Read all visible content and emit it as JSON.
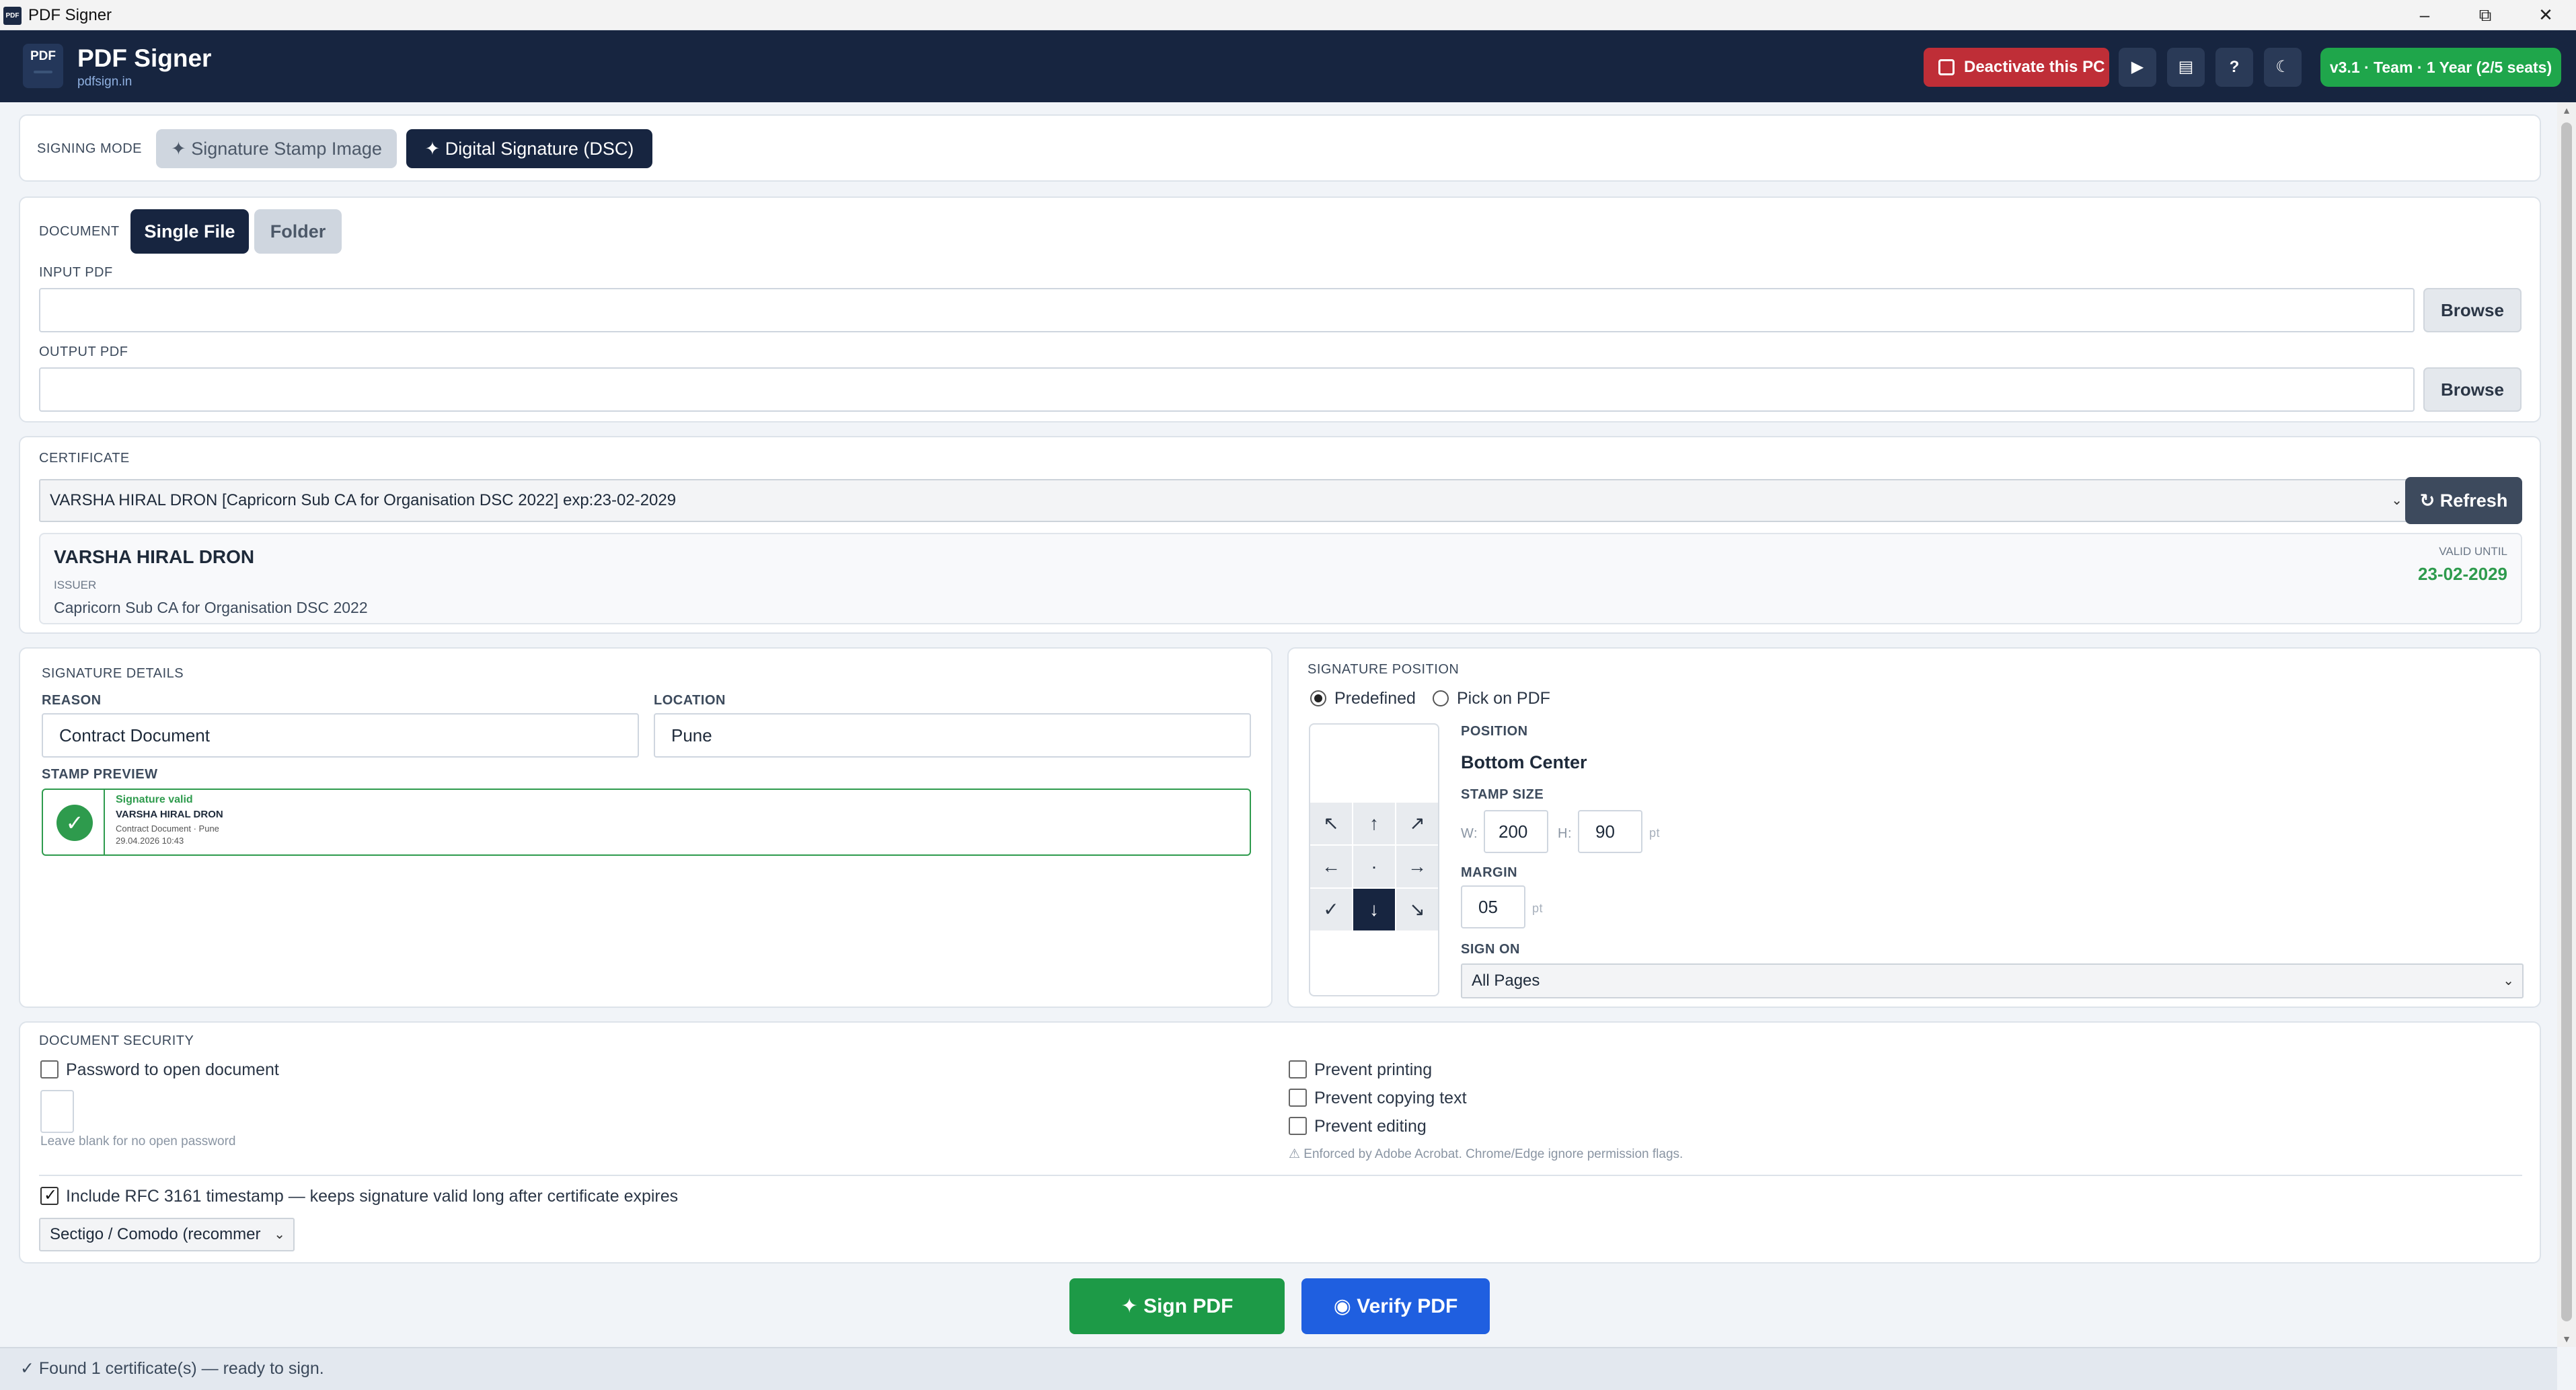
{
  "window": {
    "title": "PDF Signer",
    "icon_text": "PDF",
    "minimize": "–",
    "maximize": "⧉",
    "close": "✕"
  },
  "header": {
    "logo_text": "PDF",
    "brand": "PDF Signer",
    "brand_sub": "pdfsign.in",
    "deactivate_label": "Deactivate this PC",
    "play_icon": "▶",
    "book_icon": "▤",
    "help_icon": "?",
    "theme_icon": "☾",
    "license_badge": "v3.1 · Team · 1 Year (2/5 seats)"
  },
  "signing_mode": {
    "label": "SIGNING MODE",
    "options": [
      "✦ Signature Stamp Image",
      "✦ Digital Signature (DSC)"
    ],
    "selected": "✦ Digital Signature (DSC)"
  },
  "document": {
    "label": "DOCUMENT",
    "tabs": [
      "Single File",
      "Folder"
    ],
    "selected": "Single File",
    "input_label": "INPUT PDF",
    "input_value": "",
    "output_label": "OUTPUT PDF",
    "output_value": "",
    "browse_label": "Browse"
  },
  "certificate": {
    "label": "CERTIFICATE",
    "selected": "VARSHA HIRAL DRON  [Capricorn Sub CA for Organisation DSC 2022]  exp:23-02-2029",
    "refresh_label": "↻ Refresh",
    "holder": "VARSHA HIRAL DRON",
    "issuer_label": "ISSUER",
    "issuer": "Capricorn Sub CA for Organisation DSC 2022",
    "valid_until_label": "VALID UNTIL",
    "valid_until": "23-02-2029"
  },
  "signature_details": {
    "label": "SIGNATURE DETAILS",
    "reason_label": "REASON",
    "reason": "Contract Document",
    "location_label": "LOCATION",
    "location": "Pune",
    "stamp_preview_label": "STAMP PREVIEW",
    "stamp": {
      "status": "Signature valid",
      "name": "VARSHA HIRAL DRON",
      "detail": "Contract Document · Pune",
      "datetime": "29.04.2026 10:43"
    }
  },
  "signature_position": {
    "label": "SIGNATURE POSITION",
    "modes": [
      "Predefined",
      "Pick on PDF"
    ],
    "selected_mode": "Predefined",
    "grid": [
      "↖",
      "↑",
      "↗",
      "←",
      "·",
      "→",
      "✓",
      "↓",
      "↘"
    ],
    "selected_cell": "↓",
    "position_label": "POSITION",
    "position": "Bottom Center",
    "stamp_size_label": "STAMP SIZE",
    "w_label": "W:",
    "width": "200",
    "h_label": "H:",
    "height": "90",
    "unit": "pt",
    "margin_label": "MARGIN",
    "margin": "05",
    "sign_on_label": "SIGN ON",
    "sign_on": "All Pages"
  },
  "security": {
    "label": "DOCUMENT SECURITY",
    "password_label": "Password to open document",
    "password_checked": false,
    "password_value": "",
    "password_hint": "Leave blank for no open password",
    "prevent_printing": "Prevent printing",
    "prevent_copying": "Prevent copying text",
    "prevent_editing": "Prevent editing",
    "permission_note": "⚠ Enforced by Adobe Acrobat. Chrome/Edge ignore permission flags.",
    "timestamp_label": "Include RFC 3161 timestamp  —  keeps signature valid long after certificate expires",
    "timestamp_checked": true,
    "tsa": "Sectigo / Comodo (recommer"
  },
  "actions": {
    "sign": "✦  Sign PDF",
    "verify": "◉  Verify PDF"
  },
  "status": "✓ Found 1 certificate(s) — ready to sign.",
  "colors": {
    "navy": "#172540",
    "green": "#1fa64b",
    "blue": "#1f5fe0",
    "red": "#bf2e37",
    "valid_green": "#2e9b4d"
  }
}
